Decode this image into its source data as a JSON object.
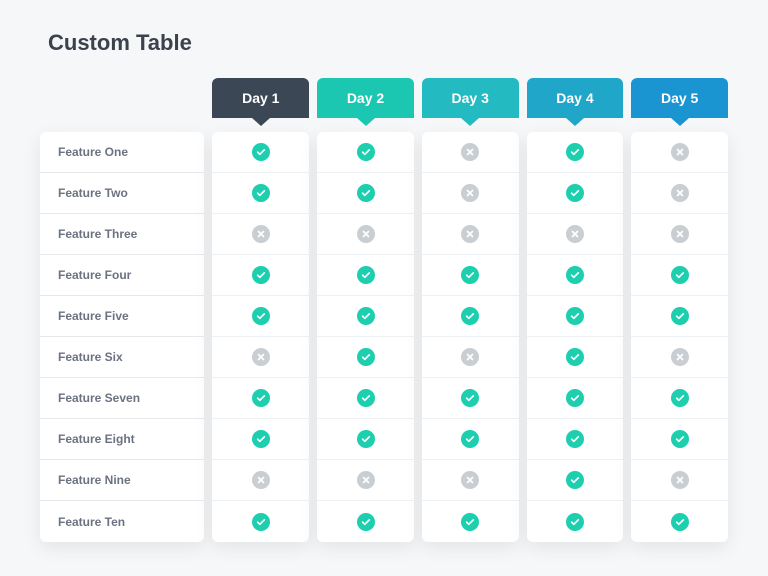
{
  "title": "Custom Table",
  "colors": {
    "check": "#1dcfaf",
    "cross": "#c9ced3",
    "headers": [
      "#3c4756",
      "#1cc7b2",
      "#23bbc1",
      "#1fa6c8",
      "#1b95d1"
    ]
  },
  "rowLabels": [
    "Feature One",
    "Feature Two",
    "Feature Three",
    "Feature Four",
    "Feature Five",
    "Feature Six",
    "Feature Seven",
    "Feature Eight",
    "Feature Nine",
    "Feature Ten"
  ],
  "columns": [
    {
      "label": "Day 1",
      "cells": [
        true,
        true,
        false,
        true,
        true,
        false,
        true,
        true,
        false,
        true
      ]
    },
    {
      "label": "Day 2",
      "cells": [
        true,
        true,
        false,
        true,
        true,
        true,
        true,
        true,
        false,
        true
      ]
    },
    {
      "label": "Day 3",
      "cells": [
        false,
        false,
        false,
        true,
        true,
        false,
        true,
        true,
        false,
        true
      ]
    },
    {
      "label": "Day 4",
      "cells": [
        true,
        true,
        false,
        true,
        true,
        true,
        true,
        true,
        true,
        true
      ]
    },
    {
      "label": "Day 5",
      "cells": [
        false,
        false,
        false,
        true,
        true,
        false,
        true,
        true,
        false,
        true
      ]
    }
  ]
}
